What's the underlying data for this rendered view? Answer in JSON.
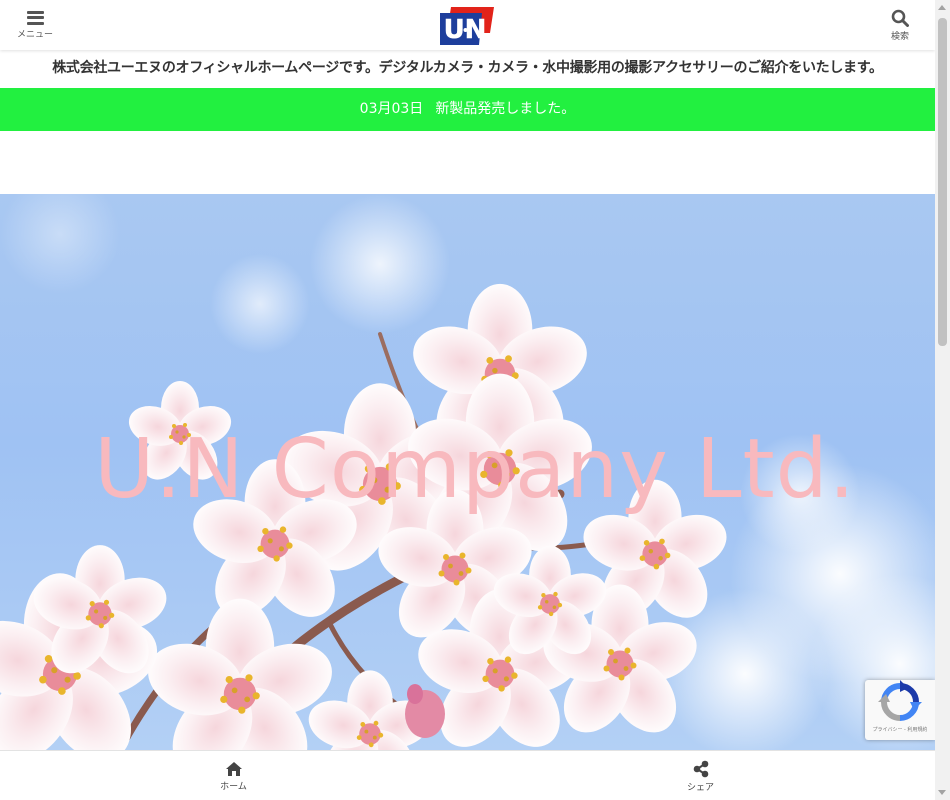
{
  "header": {
    "menu_label": "メニュー",
    "search_label": "検索",
    "logo_text": "U·N"
  },
  "tagline": "株式会社ユーエヌのオフィシャルホームページです。デジタルカメラ・カメラ・水中撮影用の撮影アクセサリーのご紹介をいたします。",
  "notice": {
    "date": "03月03日",
    "text": "新製品発売しました。"
  },
  "hero": {
    "title": "U.N Company Ltd."
  },
  "recaptcha": {
    "text": "プライバシー - 利用規約"
  },
  "bottom_nav": {
    "home_label": "ホーム",
    "share_label": "シェア"
  },
  "colors": {
    "notice_bg": "#22f040",
    "hero_title": "#f8b9be",
    "logo_red": "#e2231a",
    "logo_blue": "#1d3e9c"
  },
  "icons": {
    "menu": "hamburger-icon",
    "search": "search-icon",
    "home": "home-icon",
    "share": "share-icon"
  }
}
